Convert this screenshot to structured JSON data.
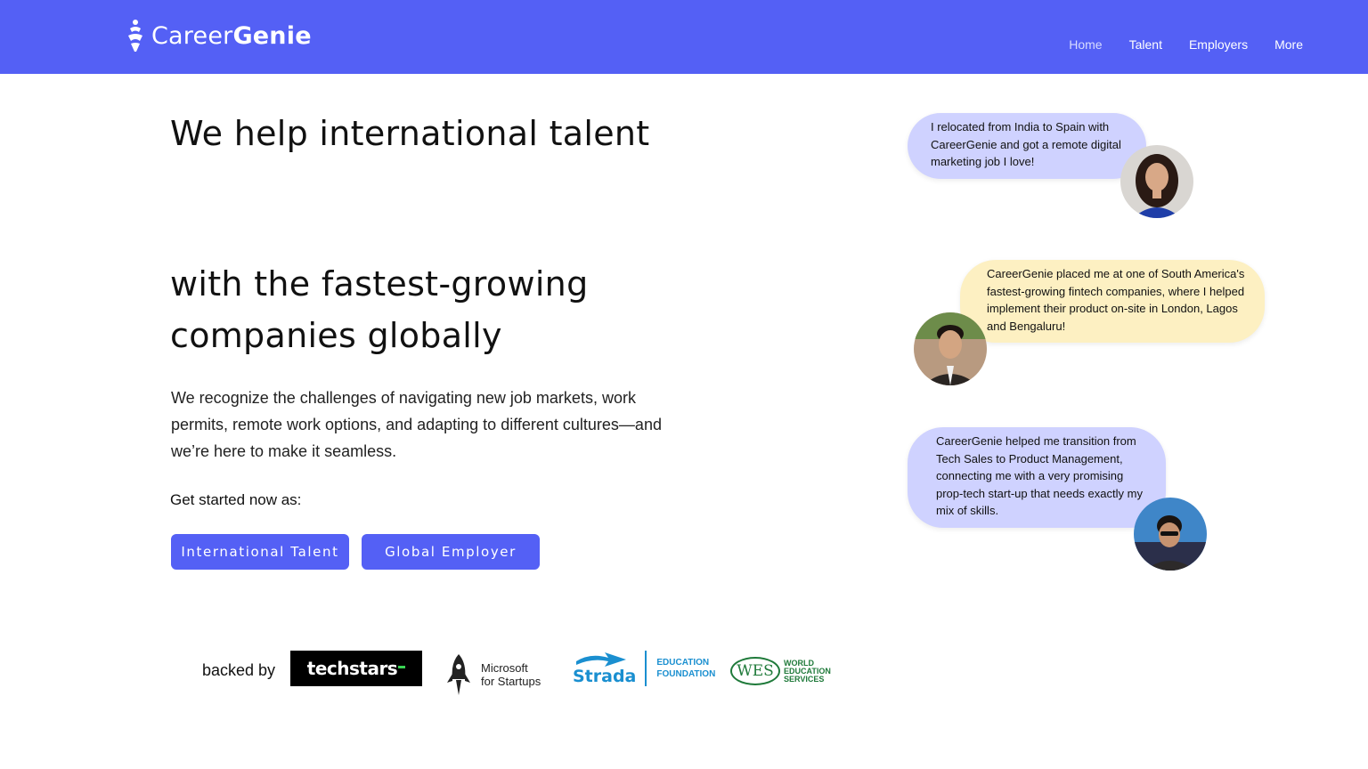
{
  "brand": {
    "name_light": "Career",
    "name_bold": "Genie"
  },
  "nav": {
    "items": [
      {
        "label": "Home"
      },
      {
        "label": "Talent"
      },
      {
        "label": "Employers"
      },
      {
        "label": "More"
      }
    ]
  },
  "hero": {
    "title_line1": "We help international talent",
    "title_line2": "with the fastest-growing companies globally",
    "description": "We recognize the challenges of navigating new job markets, work permits, remote work options, and adapting to different cultures—and we’re here to make it seamless.",
    "get_started": "Get started now as:",
    "btn_talent": "International Talent",
    "btn_employer": "Global Employer"
  },
  "backed": {
    "label": "backed by",
    "techstars": "techstars",
    "microsoft_line1": "Microsoft",
    "microsoft_line2": "for Startups",
    "strada": "Strada",
    "strada_line1": "EDUCATION",
    "strada_line2": "FOUNDATION",
    "wes": "WES",
    "wes_line1": "WORLD",
    "wes_line2": "EDUCATION",
    "wes_line3": "SERVICES"
  },
  "testimonials": [
    {
      "text": "I relocated from India to Spain with CareerGenie and got a remote digital marketing job I love!"
    },
    {
      "text": "CareerGenie placed me at one of South America's fastest-growing fintech companies, where I helped implement their product on-site in London, Lagos and Bengaluru!"
    },
    {
      "text": "CareerGenie helped me transition from Tech Sales to Product Management, connecting me with a very promising prop-tech start-up that needs exactly my mix of skills."
    }
  ],
  "colors": {
    "primary": "#5460f5",
    "bubble_purple": "#cfd2ff",
    "bubble_yellow": "#fdf0c2"
  }
}
